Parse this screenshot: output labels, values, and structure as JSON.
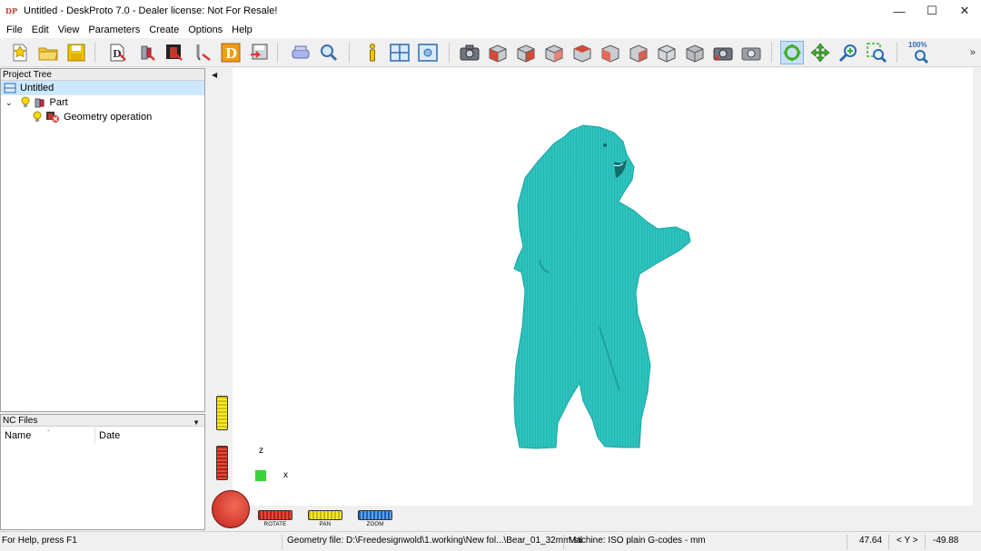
{
  "app": {
    "icon_text": "DP",
    "title": "Untitled - DeskProto 7.0 - Dealer license: Not For Resale!"
  },
  "window_controls": {
    "minimize": "—",
    "maximize": "☐",
    "close": "✕"
  },
  "menu": [
    "File",
    "Edit",
    "View",
    "Parameters",
    "Create",
    "Options",
    "Help"
  ],
  "toolbar": {
    "zoom_label": "100%",
    "overflow": "»",
    "active_tool": "rotate-view"
  },
  "project_tree": {
    "header": "Project Tree",
    "root": "Untitled",
    "part": "Part",
    "operation": "Geometry operation"
  },
  "nc_files": {
    "header": "NC Files",
    "columns": [
      "Name",
      "Date"
    ]
  },
  "viewport": {
    "axis_z": "z",
    "axis_x": "x",
    "model_color": "#2ec4c0"
  },
  "wheels": {
    "rotate": "ROTATE",
    "pan": "PAN",
    "zoom": "ZOOM"
  },
  "status": {
    "help": "For Help, press F1",
    "geometry_file": "Geometry file: D:\\Freedesignwold\\1.working\\New fol...\\Bear_01_32mm.stl",
    "machine": "Machine: ISO plain G-codes - mm",
    "coord_left": "47.64",
    "coord_axis": "< Y >",
    "coord_right": "-49.88"
  }
}
